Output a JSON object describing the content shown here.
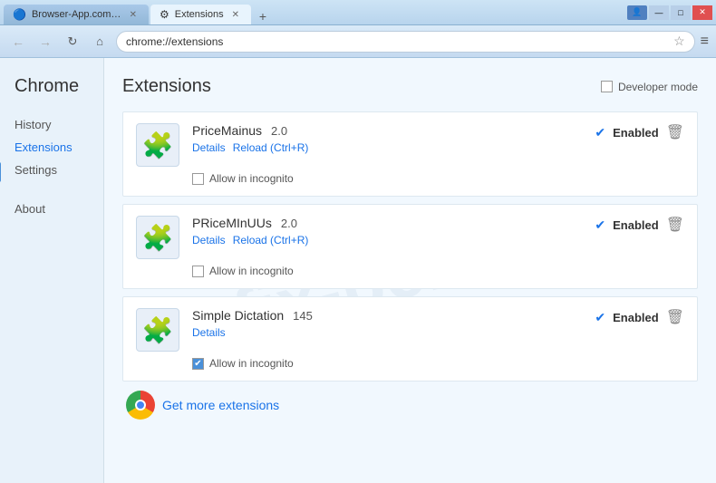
{
  "window": {
    "title": "Extensions",
    "controls": {
      "minimize": "—",
      "maximize": "□",
      "close": "✕",
      "user": "👤"
    }
  },
  "tabs": [
    {
      "label": "Browser-App.com - A fre...",
      "favicon": "🔵",
      "active": false
    },
    {
      "label": "Extensions",
      "favicon": "⚙",
      "active": true
    }
  ],
  "toolbar": {
    "back_disabled": true,
    "forward_disabled": true,
    "url": "chrome://extensions",
    "star": "☆",
    "menu": "≡"
  },
  "sidebar": {
    "title": "Chrome",
    "items": [
      {
        "label": "History",
        "active": false
      },
      {
        "label": "Extensions",
        "active": true
      },
      {
        "label": "Settings",
        "active": false
      },
      {
        "label": "About",
        "active": false
      }
    ]
  },
  "main": {
    "page_title": "Extensions",
    "developer_mode_label": "Developer mode",
    "extensions": [
      {
        "name": "PriceMainus",
        "version": "2.0",
        "details_link": "Details",
        "reload_link": "Reload (Ctrl+R)",
        "enabled": true,
        "enabled_label": "Enabled",
        "allow_incognito": false,
        "allow_incognito_label": "Allow in incognito"
      },
      {
        "name": "PRiceMInUUs",
        "version": "2.0",
        "details_link": "Details",
        "reload_link": "Reload (Ctrl+R)",
        "enabled": true,
        "enabled_label": "Enabled",
        "allow_incognito": false,
        "allow_incognito_label": "Allow in incognito"
      },
      {
        "name": "Simple Dictation",
        "version": "145",
        "details_link": "Details",
        "reload_link": null,
        "enabled": true,
        "enabled_label": "Enabled",
        "allow_incognito": true,
        "allow_incognito_label": "Allow in incognito"
      }
    ],
    "get_more_label": "Get more extensions"
  }
}
